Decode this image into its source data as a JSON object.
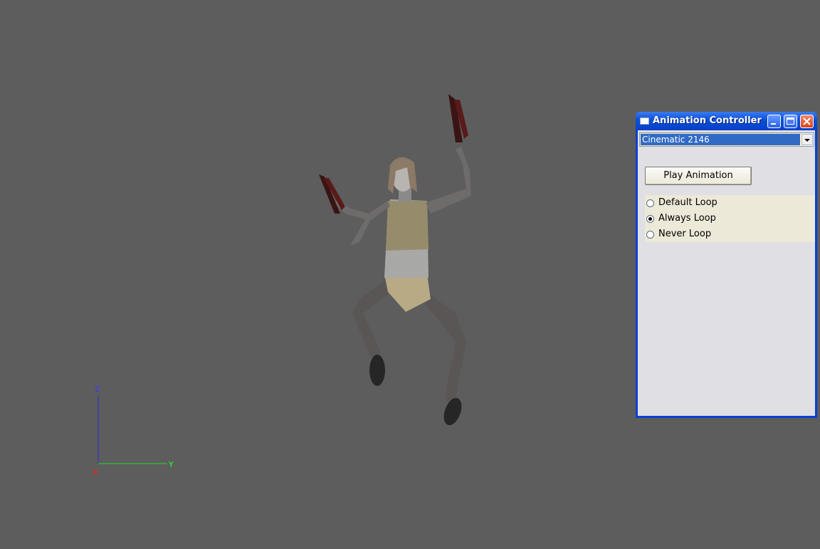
{
  "viewport": {
    "background": "#5d5d5d",
    "axis_labels": {
      "z": "Z",
      "y": "Y",
      "x": "X"
    },
    "axis_colors": {
      "z": "#3a3aff",
      "y": "#2aff2a",
      "x": "#ff2020"
    }
  },
  "window": {
    "title": "Animation Controller",
    "icon": "window-icon",
    "controls": [
      "minimize-icon",
      "maximize-icon",
      "close-icon"
    ],
    "animation_select": {
      "value": "Cinematic 2146"
    },
    "play_button_label": "Play Animation",
    "loop_options": [
      {
        "label": "Default Loop",
        "checked": false
      },
      {
        "label": "Always Loop",
        "checked": true
      },
      {
        "label": "Never Loop",
        "checked": false
      }
    ]
  }
}
